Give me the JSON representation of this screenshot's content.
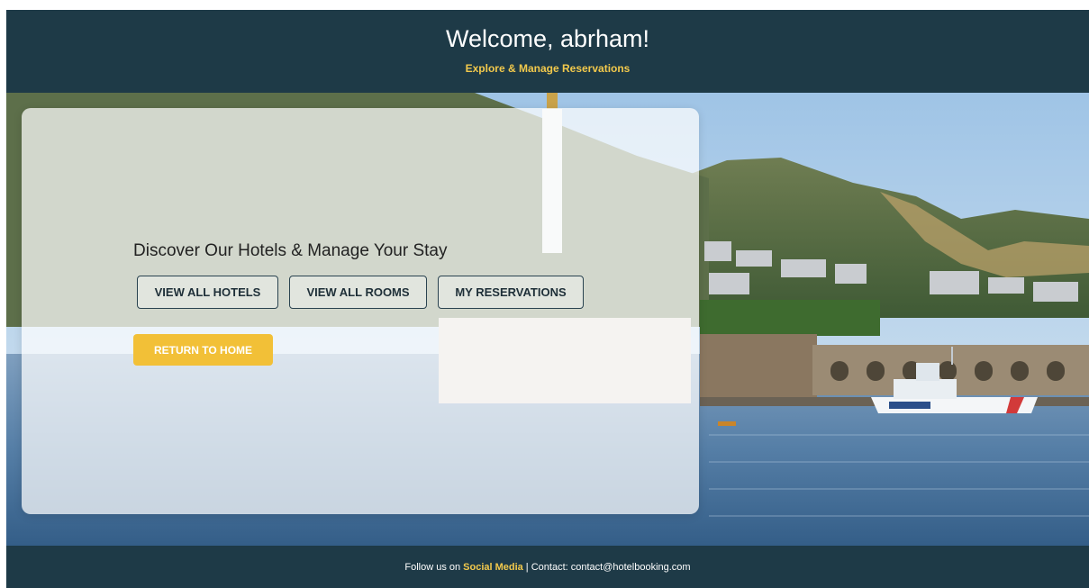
{
  "header": {
    "title": "Welcome, abrham!",
    "subtitle": "Explore & Manage Reservations"
  },
  "main": {
    "heading": "Discover Our Hotels & Manage Your Stay",
    "buttons": {
      "view_hotels": "VIEW ALL HOTELS",
      "view_rooms": "VIEW ALL ROOMS",
      "my_reservations": "MY RESERVATIONS",
      "return_home": "RETURN TO HOME"
    }
  },
  "footer": {
    "prefix": "Follow us on",
    "social_link": "Social Media",
    "contact": "| Contact: contact@hotelbooking.com"
  },
  "colors": {
    "header_bg": "#1e3a47",
    "accent": "#f2c94c",
    "button_primary": "#f2c037"
  }
}
